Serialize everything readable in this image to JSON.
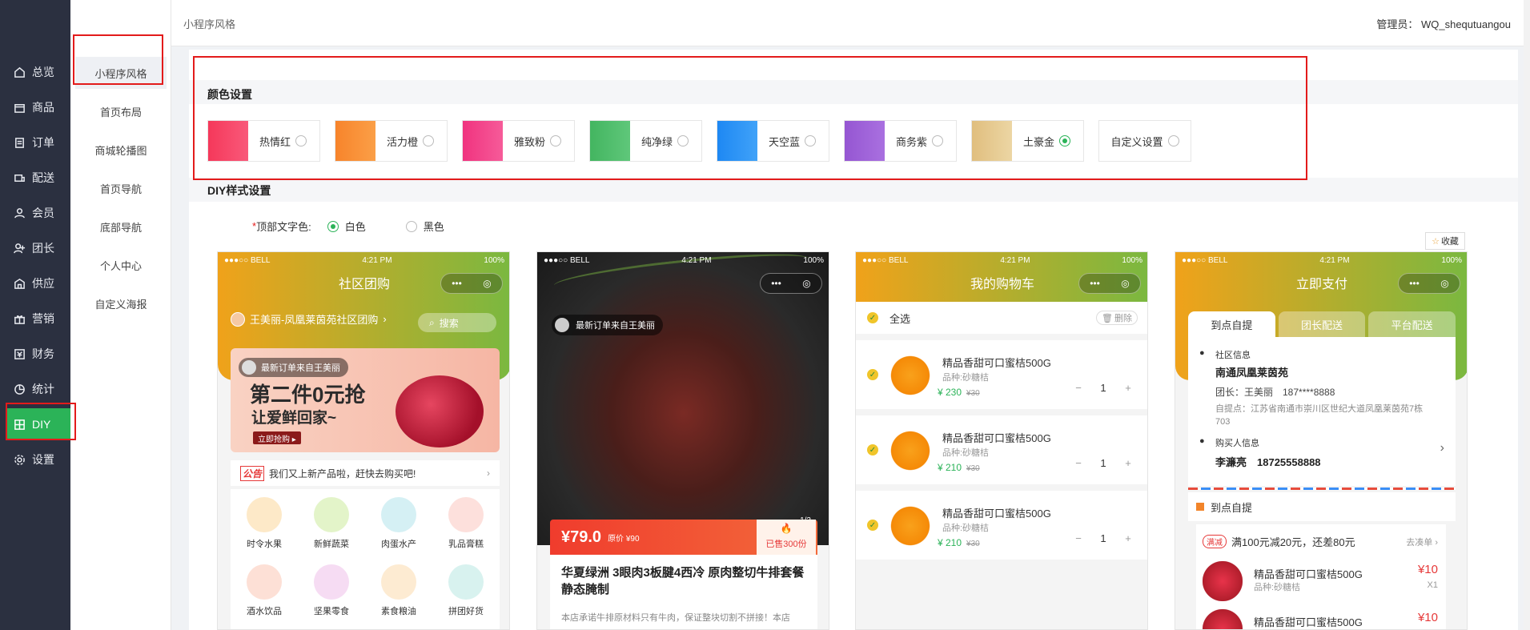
{
  "sidebar": {
    "items": [
      {
        "label": "总览",
        "icon": "home-icon"
      },
      {
        "label": "商品",
        "icon": "box-icon"
      },
      {
        "label": "订单",
        "icon": "order-icon"
      },
      {
        "label": "配送",
        "icon": "delivery-icon"
      },
      {
        "label": "会员",
        "icon": "user-icon"
      },
      {
        "label": "团长",
        "icon": "leader-icon"
      },
      {
        "label": "供应",
        "icon": "supply-icon"
      },
      {
        "label": "营销",
        "icon": "gift-icon"
      },
      {
        "label": "财务",
        "icon": "finance-icon"
      },
      {
        "label": "统计",
        "icon": "chart-icon"
      },
      {
        "label": "DIY",
        "icon": "grid-icon"
      },
      {
        "label": "设置",
        "icon": "gear-icon"
      }
    ]
  },
  "submenu": {
    "items": [
      "小程序风格",
      "首页布局",
      "商城轮播图",
      "首页导航",
      "底部导航",
      "个人中心",
      "自定义海报"
    ]
  },
  "header": {
    "breadcrumb": "小程序风格",
    "admin": "管理员： WQ_shequtuangou"
  },
  "colors_section": {
    "title": "颜色设置",
    "swatches": [
      {
        "label": "热情红",
        "color": "#f5385a",
        "selected": false
      },
      {
        "label": "活力橙",
        "color": "#f7842b",
        "selected": false
      },
      {
        "label": "雅致粉",
        "color": "#f0337f",
        "selected": false
      },
      {
        "label": "纯净绿",
        "color": "#43b560",
        "selected": false
      },
      {
        "label": "天空蓝",
        "color": "#1e88f3",
        "selected": false
      },
      {
        "label": "商务紫",
        "color": "#9556d2",
        "selected": false
      },
      {
        "label": "土豪金",
        "color": "#e5c98a",
        "selected": true
      },
      {
        "label": "自定义设置",
        "color": "",
        "selected": false
      }
    ]
  },
  "diy_section": {
    "title": "DIY样式设置",
    "top_text_label": "顶部文字色:",
    "required_mark": "*",
    "options": [
      {
        "label": "白色",
        "selected": true
      },
      {
        "label": "黑色",
        "selected": false
      }
    ],
    "fav_label": "收藏"
  },
  "phone_status": {
    "carrier": "●●●○○ BELL",
    "time": "4:21 PM",
    "battery": "100%",
    "capsule_more": "•••",
    "capsule_target": "◎"
  },
  "phone1": {
    "title": "社区团购",
    "location": "王美丽-凤凰莱茵苑社区团购",
    "search": "搜索",
    "banner_tip": "最新订单来自王美丽",
    "banner_big": "第二件0元抢",
    "banner_sub": "让爱鲜回家~",
    "banner_btn": "立即抢购 ▸",
    "notice_tag": "公告",
    "notice_text": "我们又上新产品啦，赶快去购买吧!",
    "categories": [
      {
        "label": "时令水果",
        "color": "#fde9c8"
      },
      {
        "label": "新鲜蔬菜",
        "color": "#e3f4c9"
      },
      {
        "label": "肉蛋水产",
        "color": "#d5f0f4"
      },
      {
        "label": "乳品膏糕",
        "color": "#fde0dc"
      },
      {
        "label": "酒水饮品",
        "color": "#fde0d6"
      },
      {
        "label": "坚果零食",
        "color": "#f6dcf3"
      },
      {
        "label": "素食粮油",
        "color": "#fdebd2"
      },
      {
        "label": "拼团好货",
        "color": "#d8f2ef"
      }
    ]
  },
  "phone2": {
    "tip": "最新订单来自王美丽",
    "page": "1/2",
    "price": "¥79.0",
    "orig": "原价 ¥90",
    "sold": "已售300份",
    "title": "华夏绿洲 3眼肉3板腱4西冷 原肉整切牛排套餐静态腌制",
    "desc": "本店承诺牛排原材料只有牛肉，保证整块切割不拼接！本店"
  },
  "phone3": {
    "title": "我的购物车",
    "select_all": "全选",
    "delete": "删除",
    "items": [
      {
        "name": "精品香甜可口蜜桔500G",
        "spec": "品种:砂糖桔",
        "price": "¥ 230",
        "orig": "¥30",
        "qty": "1"
      },
      {
        "name": "精品香甜可口蜜桔500G",
        "spec": "品种:砂糖桔",
        "price": "¥ 210",
        "orig": "¥30",
        "qty": "1"
      },
      {
        "name": "精品香甜可口蜜桔500G",
        "spec": "品种:砂糖桔",
        "price": "¥ 210",
        "orig": "¥30",
        "qty": "1"
      }
    ],
    "minus": "−",
    "plus": "+"
  },
  "phone4": {
    "title": "立即支付",
    "tabs": [
      "到点自提",
      "团长配送",
      "平台配送"
    ],
    "community_label": "社区信息",
    "community_name": "南通凤凰莱茵苑",
    "leader": "团长：王美丽　187****8888",
    "address": "自提点：江苏省南通市崇川区世纪大道凤凰莱茵苑7栋703",
    "buyer_label": "购买人信息",
    "buyer": "李濂亮　18725558888",
    "pickup": "到点自提",
    "promo_tag": "满减",
    "promo": "满100元减20元，还差80元",
    "promo_go": "去凑单 ›",
    "goods": [
      {
        "name": "精品香甜可口蜜桔500G",
        "spec": "品种:砂糖桔",
        "price": "¥10",
        "qty": "X1"
      },
      {
        "name": "精品香甜可口蜜桔500G",
        "spec": "",
        "price": "¥10",
        "qty": ""
      }
    ]
  }
}
